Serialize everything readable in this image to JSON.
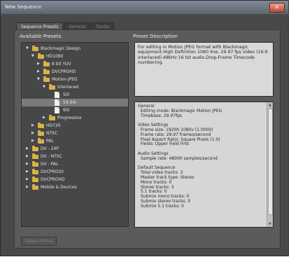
{
  "window": {
    "title": "New Sequence",
    "close_icon": "close-icon"
  },
  "tabs": [
    {
      "label": "Sequence Presets"
    },
    {
      "label": "General"
    },
    {
      "label": "Tracks"
    }
  ],
  "presets": {
    "title": "Available Presets",
    "tree": [
      {
        "label": "Blackmagic Design",
        "depth": 0,
        "expanded": true,
        "kind": "folder"
      },
      {
        "label": "HD1080",
        "depth": 1,
        "expanded": true,
        "kind": "folder"
      },
      {
        "label": "8 bit YUV",
        "depth": 2,
        "expanded": false,
        "kind": "folder"
      },
      {
        "label": "DVCPROHD",
        "depth": 2,
        "expanded": false,
        "kind": "folder"
      },
      {
        "label": "Motion-JPEG",
        "depth": 2,
        "expanded": true,
        "kind": "folder"
      },
      {
        "label": "Interlaced",
        "depth": 3,
        "expanded": true,
        "kind": "folder"
      },
      {
        "label": "50i",
        "depth": 4,
        "kind": "file"
      },
      {
        "label": "59.94i",
        "depth": 4,
        "kind": "file",
        "selected": true
      },
      {
        "label": "60i",
        "depth": 4,
        "kind": "file"
      },
      {
        "label": "Progressive",
        "depth": 3,
        "expanded": false,
        "kind": "folder"
      },
      {
        "label": "HD720",
        "depth": 1,
        "expanded": false,
        "kind": "folder"
      },
      {
        "label": "NTSC",
        "depth": 1,
        "expanded": false,
        "kind": "folder"
      },
      {
        "label": "PAL",
        "depth": 1,
        "expanded": false,
        "kind": "folder"
      },
      {
        "label": "DV - 24P",
        "depth": 0,
        "expanded": false,
        "kind": "folder"
      },
      {
        "label": "DV - NTSC",
        "depth": 0,
        "expanded": false,
        "kind": "folder"
      },
      {
        "label": "DV - PAL",
        "depth": 0,
        "expanded": false,
        "kind": "folder"
      },
      {
        "label": "DVCPRO50",
        "depth": 0,
        "expanded": false,
        "kind": "folder"
      },
      {
        "label": "DVCPROHD",
        "depth": 0,
        "expanded": false,
        "kind": "folder"
      },
      {
        "label": "Mobile & Devices",
        "depth": 0,
        "expanded": false,
        "kind": "folder"
      }
    ]
  },
  "description": {
    "title": "Preset Description",
    "text": "For editing in Motion JPEG format with Blackmagic equipment.High Definition 1080 line, 29.97 fps video (16:9 interlaced).48kHz 16 bit audio.Drop-Frame Timecode numbering."
  },
  "details": {
    "lines": [
      "General",
      "  Editing mode: Blackmagic Motion JPEG",
      "  Timebase: 29.97fps",
      "",
      "Video Settings",
      "  Frame size: 1920h 1080v (1.0000)",
      "  Frame rate: 29.97 frames/second",
      "  Pixel Aspect Ratio: Square Pixels (1.0)",
      "  Fields: Upper Field First",
      "",
      "Audio Settings",
      "  Sample rate: 48000 samples/second",
      "",
      "Default Sequence",
      "  Total video tracks: 3",
      "  Master track type: Stereo",
      "  Mono tracks: 0",
      "  Stereo tracks: 3",
      "  5.1 tracks: 0",
      "  Submix mono tracks: 0",
      "  Submix stereo tracks: 0",
      "  Submix 5.1 tracks: 0"
    ]
  },
  "buttons": {
    "delete": "Delete Preset"
  },
  "colors": {
    "accent_folder": "#d8b24a",
    "selected_row": "#7a7a7a",
    "panel_bg": "#5b5b5b"
  }
}
